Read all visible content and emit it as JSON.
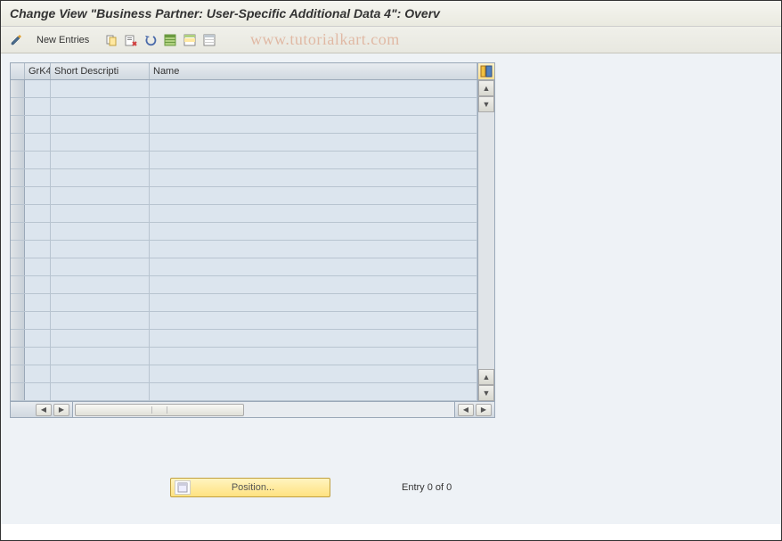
{
  "title": "Change View \"Business Partner: User-Specific Additional Data 4\": Overv",
  "toolbar": {
    "new_entries": "New Entries"
  },
  "watermark": "www.tutorialkart.com",
  "grid": {
    "columns": {
      "grk4": "GrK4",
      "short_desc": "Short Descripti",
      "name": "Name"
    },
    "row_count": 18
  },
  "position_button": "Position...",
  "entry_status": "Entry 0 of 0",
  "icons": {
    "edit": "toggle-display-change-icon",
    "copy": "copy-as-icon",
    "delete": "delete-icon",
    "undo": "undo-change-icon",
    "select_all": "select-all-icon",
    "select_block": "select-block-icon",
    "deselect_all": "deselect-all-icon",
    "config": "table-settings-icon",
    "position_icon": "position-icon"
  },
  "scroll": {
    "up": "▲",
    "down": "▼",
    "left": "◀",
    "right": "▶",
    "page_up": "▲",
    "page_down": "▼"
  }
}
